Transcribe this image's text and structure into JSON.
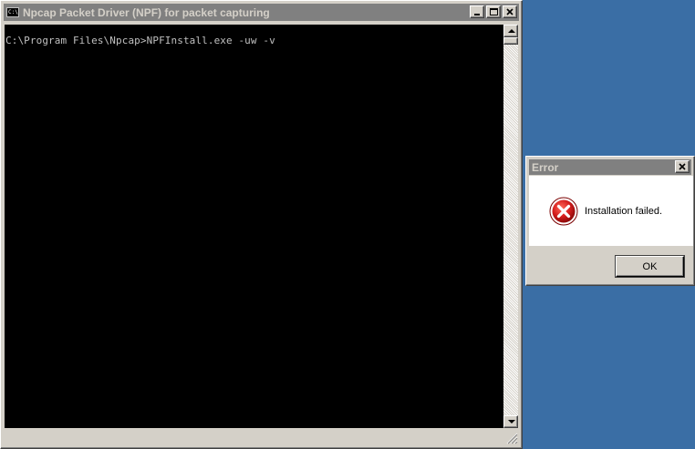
{
  "console": {
    "title": "Npcap Packet Driver (NPF) for packet capturing",
    "icon_text": "C:\\",
    "output_line": "C:\\Program Files\\Npcap>NPFInstall.exe -uw -v"
  },
  "dialog": {
    "title": "Error",
    "message": "Installation failed.",
    "ok_label": "OK"
  },
  "icons": {
    "console_icon": "cmd-window-icon",
    "error_icon": "error-x-icon"
  },
  "colors": {
    "desktop": "#3a6ea5",
    "inactive_title": "#808080",
    "console_bg": "#000000",
    "console_text": "#c0c0c0",
    "error_red": "#cc1010"
  }
}
